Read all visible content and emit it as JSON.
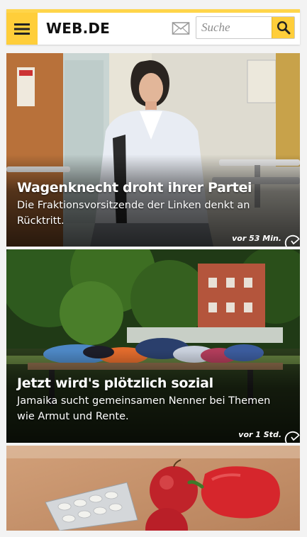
{
  "header": {
    "logo": "WEB.DE",
    "menu_icon": "hamburger-menu-icon",
    "mail_icon": "envelope-icon",
    "search_placeholder": "Suche",
    "search_icon": "magnifier-icon",
    "accent_color": "#ffce3a"
  },
  "articles": [
    {
      "headline": "Wagenknecht droht ihrer Partei",
      "teaser": "Die Fraktionsvorsitzende der Linken denkt an Rücktritt.",
      "time": "vor 53 Min.",
      "image": "woman-in-white-jacket-photo"
    },
    {
      "headline": "Jetzt wird's plötzlich sozial",
      "teaser": "Jamaika sucht gemeinsamen Nenner bei Themen wie Armut und Rente.",
      "time": "vor 1 Std.",
      "image": "clothes-on-bench-photo"
    },
    {
      "image": "pills-apples-pepper-photo"
    }
  ]
}
